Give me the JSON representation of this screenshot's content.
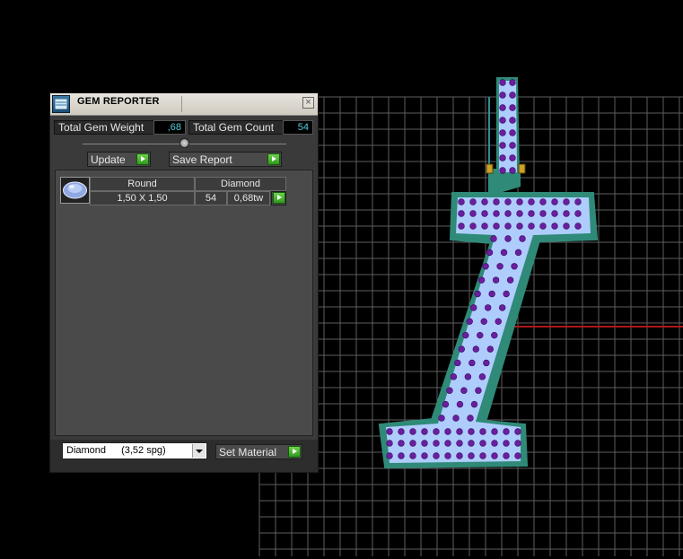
{
  "panel": {
    "title": "GEM REPORTER",
    "close_glyph": "×",
    "total_weight_label": "Total Gem Weight",
    "total_weight_value": ",68",
    "total_count_label": "Total Gem Count",
    "total_count_value": "54",
    "update_label": "Update",
    "save_report_label": "Save Report",
    "gem_row": {
      "shape": "Round",
      "size": "1,50 X 1,50",
      "material": "Diamond",
      "count": "54",
      "weight": "0,68tw"
    },
    "material_select": {
      "value": "Diamond",
      "gravity": "(3,52 spg)"
    },
    "set_material_label": "Set Material"
  },
  "colors": {
    "grid": "#5e5e5e",
    "gem_fill": "#aecdfd",
    "gem_dot": "#6a1fa0",
    "outline": "#2f8a78",
    "axis_red": "#b01818",
    "value_text": "#4fd0e0",
    "play_button": "#4fb83a"
  },
  "icons": {
    "app": "gem-reporter-icon",
    "close": "close-icon",
    "play": "play-arrow-icon",
    "dropdown": "chevron-down-icon",
    "gem": "round-gem-icon"
  }
}
